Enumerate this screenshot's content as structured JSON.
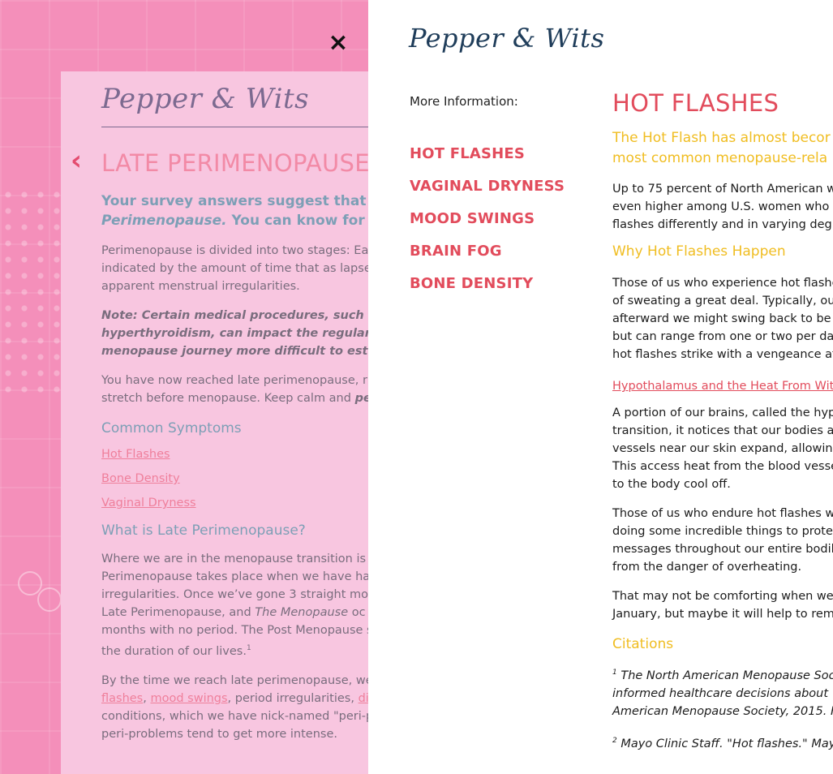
{
  "close_label": "×",
  "background_card": {
    "logo": "Pepper & Wits",
    "back_icon": "chevron-left-icon",
    "title": "LATE PERIMENOPAUSE",
    "lead_lines": [
      "Your survey answers suggest that you",
      "Perimenopause. You can know for sur"
    ],
    "lead_italic": "Perimenopause.",
    "lead_rest": " You can know for sur",
    "p1": [
      "Perimenopause is divided into two stages: Ear",
      "indicated by the amount of time that as lapse",
      "apparent menstrual irregularities."
    ],
    "note": [
      "Note: Certain medical procedures, such as hy",
      "hyperthyroidism, can impact the regularity of",
      "menopause journey more difficult to estimate"
    ],
    "p2_line1": "You have now reached late perimenopause, r",
    "p2_line2_start": "stretch before menopause. Keep calm and ",
    "p2_line2_italic": "pe",
    "symptoms_heading": "Common Symptoms",
    "symptom_links": [
      "Hot Flashes",
      "Bone Density",
      "Vaginal Dryness"
    ],
    "what_heading": "What is Late Perimenopause?",
    "p3_line1": "Where we are in the menopause transition is c",
    "p3_line2": "Perimenopause takes place when we have ha",
    "p3_line3": "irregularities. Once we’ve gone 3 straight mon",
    "p3_line4_start": "Late Perimenopause, and ",
    "p3_line4_italic": "The Menopause",
    "p3_line4_end": " oc",
    "p3_line5": "months with no period. The Post Menopause s",
    "p3_line6": "the duration of our lives.",
    "p3_sup": "1",
    "p4_line1": "By the time we reach late perimenopause, we",
    "p4_link1": "flashes",
    "p4_sep1": ", ",
    "p4_link2": "mood swings",
    "p4_mid": ", period irregularities, ",
    "p4_link3": "di",
    "p4_line3": "conditions, which we have nick-named \"peri-p",
    "p4_line4": "peri-problems tend to get more intense."
  },
  "panel": {
    "logo": "Pepper & Wits",
    "more_info_label": "More Information:",
    "nav": [
      "HOT FLASHES",
      "VAGINAL DRYNESS",
      "MOOD SWINGS",
      "BRAIN FOG",
      "BONE DENSITY"
    ]
  },
  "content": {
    "title": "HOT FLASHES",
    "lead": [
      "The Hot Flash has almost becor",
      "most common menopause-rela"
    ],
    "p1": [
      "Up to 75 percent of North American w",
      "even higher among U.S. women who",
      "flashes differently and in varying deg"
    ],
    "h_why": "Why Hot Flashes Happen",
    "p2": [
      "Those of us who experience hot flashe",
      "of sweating a great deal. Typically, ou",
      "afterward we might swing back to be",
      "but can range from one or two per da",
      "hot flashes strike with a vengeance at"
    ],
    "link_hypothalamus": "Hypothalamus and the Heat From Wit",
    "p3": [
      "A portion of our brains, called the hyp",
      "transition, it notices that our bodies ar",
      "vessels near our skin expand, allowing",
      "This access heat from the blood vesse",
      "to the body cool off."
    ],
    "p4": [
      "Those of us who endure hot flashes w",
      "doing some incredible things to prote",
      "messages throughout our entire bodil",
      "from the danger of overheating."
    ],
    "p5": [
      "That may not be comforting when we",
      "January, but maybe it will help to rem"
    ],
    "h_citations": "Citations",
    "cite1_num": "1",
    "cite1": [
      "The North American Menopause Soc",
      "informed healthcare decisions about",
      "American Menopause Society, 2015. F"
    ],
    "cite2_num": "2",
    "cite2": "Mayo Clinic Staff. \"Hot flashes.\" May"
  }
}
